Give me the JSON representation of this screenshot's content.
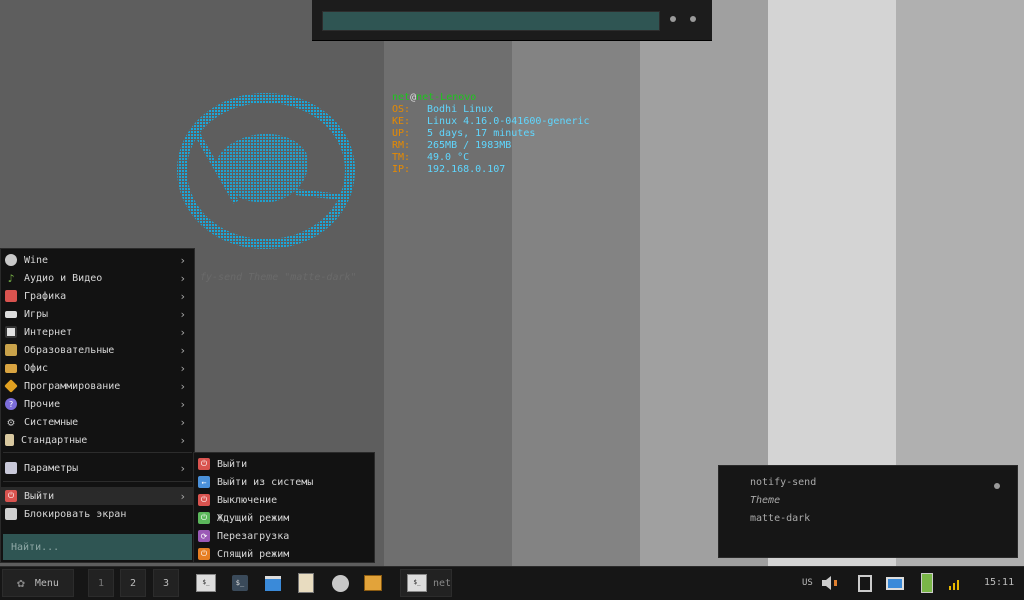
{
  "top_search": {
    "placeholder": ""
  },
  "terminal": {
    "user": "net",
    "at": "@",
    "host": "net-Lenovo",
    "rows": [
      {
        "label": "OS:",
        "value": "Bodhi Linux"
      },
      {
        "label": "KE:",
        "value": "Linux 4.16.0-041600-generic"
      },
      {
        "label": "UP:",
        "value": "5 days, 17 minutes"
      },
      {
        "label": "RM:",
        "value": "265MB / 1983MB"
      },
      {
        "label": "TM:",
        "value": "49.0 °C"
      },
      {
        "label": "IP:",
        "value": "192.168.0.107"
      }
    ],
    "ghost": "fy-send Theme \"matte-dark\""
  },
  "menu": {
    "items": [
      {
        "label": "Wine",
        "icon": "wine-icon",
        "color": "#c8c8c8"
      },
      {
        "label": "Аудио и Видео",
        "icon": "music-icon",
        "color": "#7ab648"
      },
      {
        "label": "Графика",
        "icon": "graphics-icon",
        "color": "#d9534f"
      },
      {
        "label": "Игры",
        "icon": "gamepad-icon",
        "color": "#cccccc"
      },
      {
        "label": "Интернет",
        "icon": "globe-icon",
        "color": "#e0e0e0"
      },
      {
        "label": "Образовательные",
        "icon": "folder-icon",
        "color": "#c9a24a"
      },
      {
        "label": "Офис",
        "icon": "briefcase-icon",
        "color": "#d9a441"
      },
      {
        "label": "Программирование",
        "icon": "code-icon",
        "color": "#e0a020"
      },
      {
        "label": "Прочие",
        "icon": "misc-icon",
        "color": "#7b6cd9"
      },
      {
        "label": "Системные",
        "icon": "gear-icon",
        "color": "#aaaaaa"
      },
      {
        "label": "Стандартные",
        "icon": "accessories-icon",
        "color": "#d9c9a0"
      }
    ],
    "settings_label": "Параметры",
    "logout_label": "Выйти",
    "lock_label": "Блокировать экран",
    "search_placeholder": "Найти..."
  },
  "submenu": {
    "items": [
      {
        "label": "Выйти",
        "icon": "power-icon",
        "color": "#d9534f"
      },
      {
        "label": "Выйти из системы",
        "icon": "logout-arrow-icon",
        "color": "#4a90d9"
      },
      {
        "label": "Выключение",
        "icon": "shutdown-icon",
        "color": "#d9534f"
      },
      {
        "label": "Ждущий режим",
        "icon": "suspend-icon",
        "color": "#5cb85c"
      },
      {
        "label": "Перезагрузка",
        "icon": "reboot-icon",
        "color": "#9b59b6"
      },
      {
        "label": "Спящий режим",
        "icon": "hibernate-icon",
        "color": "#e67e22"
      }
    ]
  },
  "notification": {
    "title": "notify-send",
    "subtitle": "Theme",
    "body": "matte-dark"
  },
  "taskbar": {
    "menu_label": "Menu",
    "workspaces": [
      "1",
      "2",
      "3"
    ],
    "task_label": "net",
    "keyboard": "US",
    "clock": "15:11"
  }
}
